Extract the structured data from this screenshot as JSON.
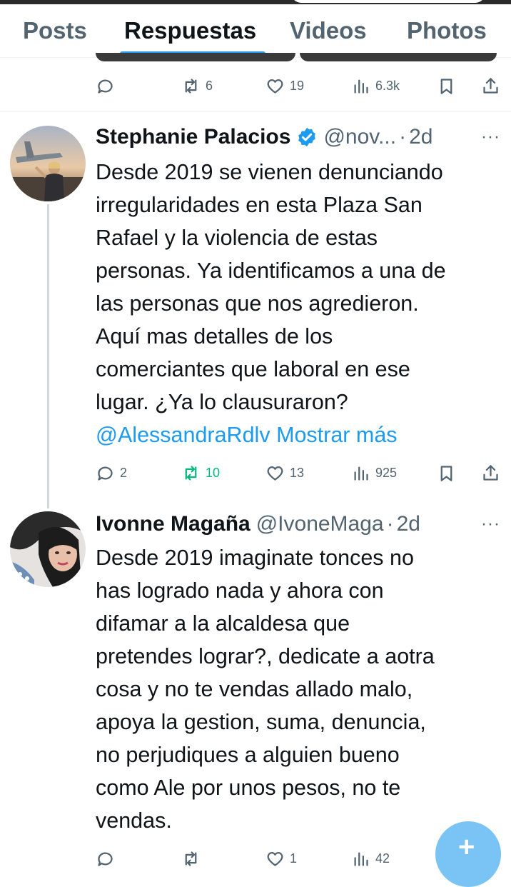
{
  "tabs": [
    "Posts",
    "Respuestas",
    "Videos",
    "Photos"
  ],
  "prev_post": {
    "replies": "",
    "reposts": "6",
    "likes": "19",
    "views": "6.3k"
  },
  "tweets": [
    {
      "name": "Stephanie Palacios",
      "verified": true,
      "handle": "@nov...",
      "time": "2d",
      "text": "Desde 2019 se vienen denunciando\nirregularidades en esta Plaza San\nRafael y la violencia de estas\npersonas. Ya identificamos a una de\nlas personas que nos agredieron.\nAquí mas detalles de los\ncomerciantes que laboral en ese\nlugar. ¿Ya lo clausuraron?",
      "mention": "@AlessandraRdlv",
      "show_more": "Mostrar más",
      "replies": "2",
      "reposts": "10",
      "likes": "13",
      "views": "925"
    },
    {
      "name": "Ivonne Magaña",
      "verified": false,
      "handle": "@IvoneMaga",
      "time": "2d",
      "text": "Desde 2019 imaginate tonces no\nhas logrado nada y ahora con\ndifamar a la alcaldesa que\npretendes lograr?, dedicate a aotra\ncosa y no te vendas allado malo,\napoya la gestion, suma, denuncia,\nno perjudiques a alguien bueno\ncomo Ale por unos pesos, no te\nvendas.",
      "likes": "1",
      "views": "42"
    }
  ],
  "separator": "·",
  "more_glyph": "···",
  "fab_icon": "+",
  "colors": {
    "accent": "#1d9bf0",
    "repost_active": "#00ba7c",
    "secondary_text": "#536471"
  }
}
